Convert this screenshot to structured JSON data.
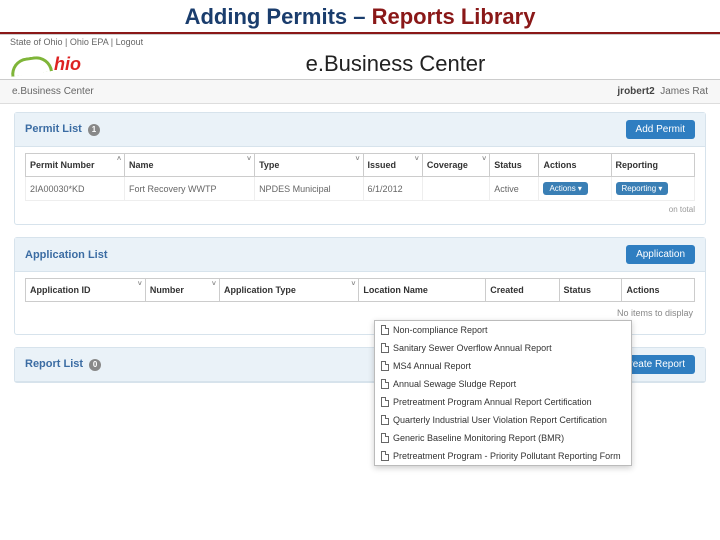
{
  "slideTitle": {
    "prefix": "Adding Permits – ",
    "emph": "Reports Library"
  },
  "topbar": {
    "state": "State of Ohio",
    "agency": "Ohio EPA",
    "logout": "Logout"
  },
  "brand": {
    "logo_text": "hio",
    "center": "e.Business Center"
  },
  "userbar": {
    "left": "e.Business Center",
    "username": "jrobert2",
    "fullname": "James Rat"
  },
  "permitPanel": {
    "title": "Permit List",
    "count": "1",
    "addBtn": "Add Permit",
    "cols": [
      "Permit Number",
      "Name",
      "Type",
      "Issued",
      "Coverage",
      "Status",
      "Actions",
      "Reporting"
    ],
    "row": {
      "permit_number": "2IA00030*KD",
      "name": "Fort Recovery WWTP",
      "type": "NPDES Municipal",
      "issued": "6/1/2012",
      "coverage": "",
      "status": "Active",
      "actions_btn": "Actions ▾",
      "reporting_btn": "Reporting ▾"
    }
  },
  "reportingMenu": [
    "Non-compliance Report",
    "Sanitary Sewer Overflow Annual Report",
    "MS4 Annual Report",
    "Annual Sewage Sludge Report",
    "Pretreatment Program Annual Report Certification",
    "Quarterly Industrial User Violation Report Certification",
    "Generic Baseline Monitoring Report (BMR)",
    "Pretreatment Program - Priority Pollutant Reporting Form"
  ],
  "appPanel": {
    "title": "Application List",
    "addBtn": "Application",
    "cols": [
      "Application ID",
      "Number",
      "Application Type",
      "Location Name",
      "Created",
      "Status",
      "Actions"
    ],
    "empty": "No items to display"
  },
  "reportPanel": {
    "title": "Report List",
    "count": "0",
    "createBtn": "Create Report"
  },
  "footer_hint": "on total"
}
